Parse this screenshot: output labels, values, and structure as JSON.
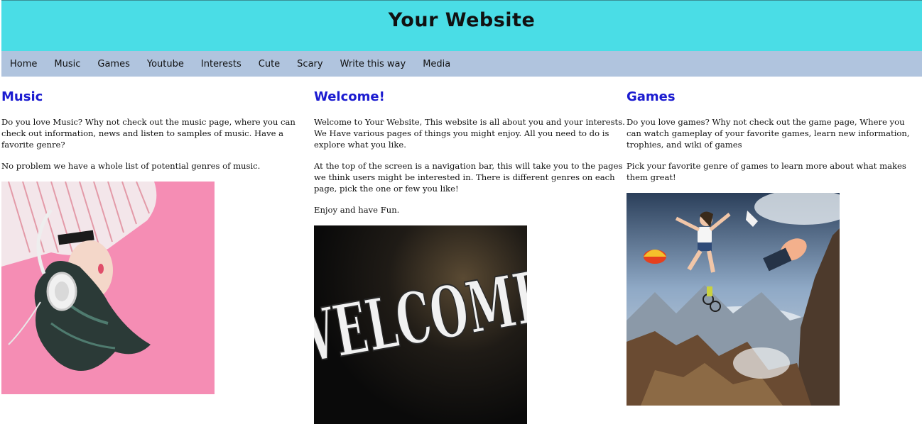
{
  "header": {
    "title": "Your Website"
  },
  "nav": {
    "items": [
      "Home",
      "Music",
      "Games",
      "Youtube",
      "Interests",
      "Cute",
      "Scary",
      "Write this way",
      "Media"
    ]
  },
  "music": {
    "heading": "Music",
    "p1": "Do you love Music? Why not check out the music page, where you can check out information, news and listen to samples of music. Have a favorite genre?",
    "p2": "No problem we have a whole list of potential genres of music."
  },
  "welcome": {
    "heading": "Welcome!",
    "p1": "Welcome to Your Website, This website is all about you and your interests. We Have various pages of things you might enjoy. All you need to do is explore what you like.",
    "p2": "At the top of the screen is a navigation bar, this will take you to the pages we think users might be interested in. There is different genres on each page, pick the one or few you like!",
    "p3": "Enjoy and have Fun.",
    "image_text": "WELCOME"
  },
  "games": {
    "heading": "Games",
    "p1": "Do you love games? Why not check out the game page, Where you can watch gameplay of your favorite games, learn new information, trophies, and wiki of games",
    "p2": "Pick your favorite genre of games to learn more about what makes them great!"
  },
  "colors": {
    "header_bg": "#4adde6",
    "nav_bg": "#b0c4de",
    "heading": "#1b1bd0"
  }
}
